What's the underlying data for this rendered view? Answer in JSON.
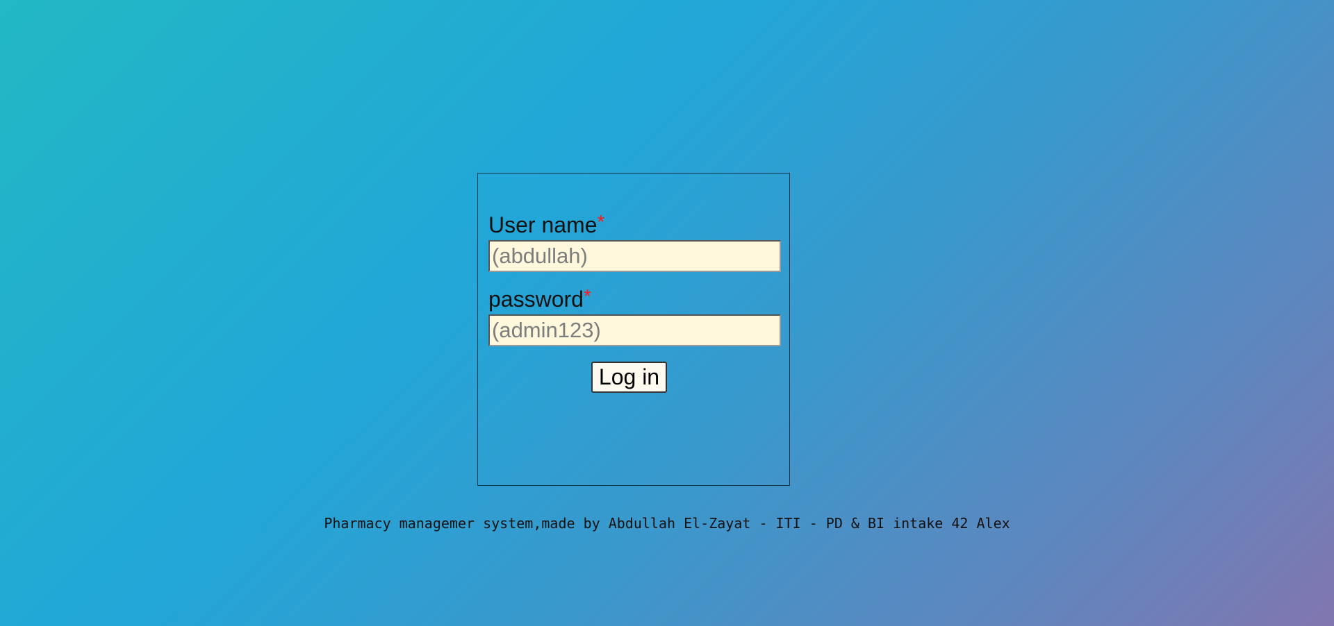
{
  "login": {
    "username_label": "User name",
    "username_required": "*",
    "username_placeholder": "(abdullah)",
    "password_label": "password",
    "password_required": "*",
    "password_placeholder": "(admin123)",
    "submit_label": "Log in"
  },
  "footer": {
    "credit": "Pharmacy managemer system,made by Abdullah El-Zayat - ITI - PD & BI intake 42 Alex"
  },
  "colors": {
    "background_start": "#22b8c4",
    "background_end": "#8276b0",
    "input_background": "#fff8dc",
    "required_marker": "#ff1a1a"
  }
}
